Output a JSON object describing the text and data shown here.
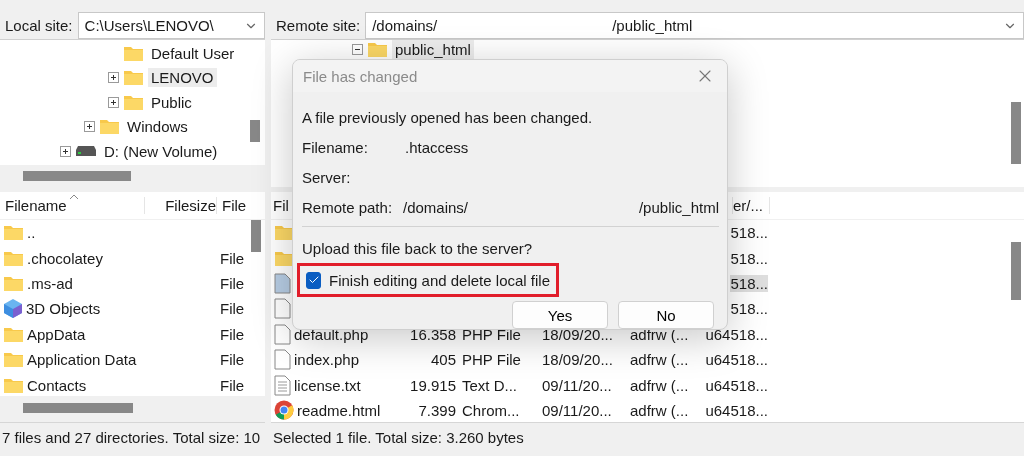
{
  "local_site": {
    "label": "Local site:",
    "value": "C:\\Users\\LENOVO\\"
  },
  "remote_site": {
    "label": "Remote site:",
    "path_start": "/domains/",
    "path_end": "/public_html"
  },
  "local_tree": [
    {
      "children": [
        {
          "children": [
            {
              "label": "Default User",
              "kind": "folder",
              "selected": false
            },
            {
              "label": "LENOVO",
              "kind": "folder",
              "expanded": false,
              "selected": true
            },
            {
              "label": "Public",
              "kind": "folder",
              "expanded": false,
              "selected": false
            }
          ]
        },
        {
          "label": "Windows",
          "kind": "folder",
          "expanded": false,
          "selected": false
        }
      ]
    },
    {
      "label": "D: (New Volume)",
      "kind": "drive",
      "expanded": false,
      "selected": false
    }
  ],
  "remote_tree": [
    {
      "label": "public_html",
      "kind": "folder",
      "expanded": true,
      "selected": true
    }
  ],
  "local_list": {
    "columns": [
      "Filename",
      "Filesize",
      "File"
    ],
    "rows": [
      {
        "kind": "folder",
        "name": ".."
      },
      {
        "kind": "folder",
        "name": ".chocolatey",
        "type": "File"
      },
      {
        "kind": "folder",
        "name": ".ms-ad",
        "type": "File"
      },
      {
        "kind": "cube",
        "name": "3D Objects",
        "type": "File"
      },
      {
        "kind": "folder",
        "name": "AppData",
        "type": "File"
      },
      {
        "kind": "folder",
        "name": "Application Data",
        "type": "File"
      },
      {
        "kind": "folder",
        "name": "Contacts",
        "type": "File"
      }
    ]
  },
  "remote_list": {
    "columns": [
      "Fil",
      "er/..."
    ],
    "rows": [
      {
        "kind": "folder",
        "owner": "518...",
        "selected": false
      },
      {
        "kind": "folder",
        "owner": "518...",
        "selected": false
      },
      {
        "kind": "file",
        "owner": "518...",
        "selected": true
      },
      {
        "kind": "file",
        "owner": "518...",
        "selected": false
      },
      {
        "kind": "file",
        "name": "default.php",
        "size": "16.358",
        "type": "PHP File",
        "date": "18/09/20...",
        "perms": "adfrw (...",
        "owner": "u64518...",
        "selected": false
      },
      {
        "kind": "file",
        "name": "index.php",
        "size": "405",
        "type": "PHP File",
        "date": "18/09/20...",
        "perms": "adfrw (...",
        "owner": "u64518...",
        "selected": false
      },
      {
        "kind": "text",
        "name": "license.txt",
        "size": "19.915",
        "type": "Text D...",
        "date": "09/11/20...",
        "perms": "adfrw (...",
        "owner": "u64518...",
        "selected": false
      },
      {
        "kind": "browser",
        "name": "readme.html",
        "size": "7.399",
        "type": "Chrom...",
        "date": "09/11/20...",
        "perms": "adfrw (...",
        "owner": "u64518...",
        "selected": false
      }
    ]
  },
  "status_local": "7 files and 27 directories. Total size: 10",
  "status_remote": "Selected 1 file. Total size: 3.260 bytes",
  "dialog": {
    "title": "File has changed",
    "message": "A file previously opened has been changed.",
    "fields": [
      {
        "label": "Filename:",
        "value": ".htaccess"
      },
      {
        "label": "Server:"
      },
      {
        "label": "Remote path:",
        "value": "/domains/",
        "value_end": "/public_html"
      }
    ],
    "question": "Upload this file back to the server?",
    "option": {
      "label": "Finish editing and delete local file",
      "checked": true,
      "highlighted": true
    },
    "buttons": [
      "Yes",
      "No"
    ]
  }
}
